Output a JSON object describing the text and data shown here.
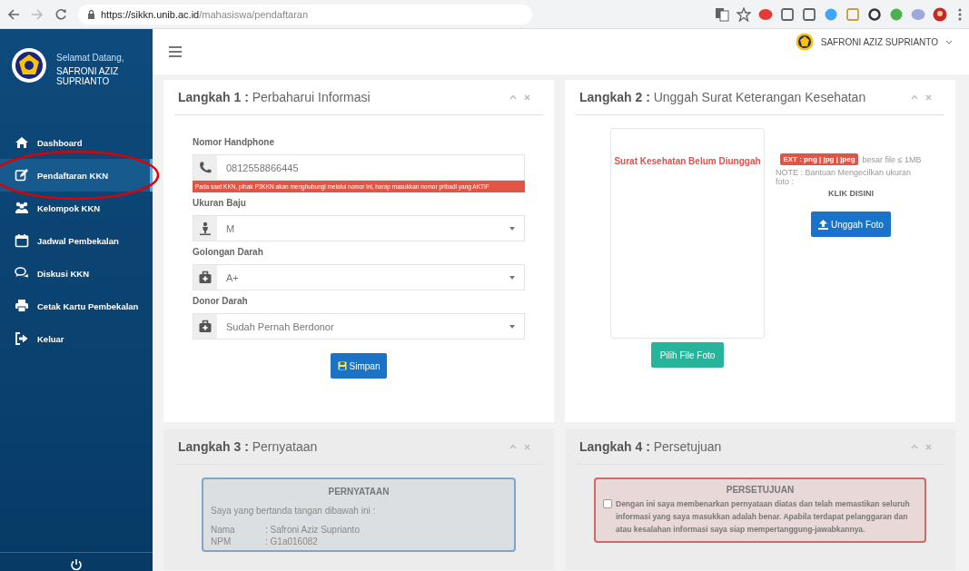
{
  "browser": {
    "url_host": "https://sikkn.unib.ac.id",
    "url_path": "/mahasiswa/pendaftaran"
  },
  "sidebar": {
    "greeting": "Selamat Datang,",
    "user_name": "SAFRONI AZIZ SUPRIANTO",
    "items": [
      {
        "label": "Dashboard",
        "selected": false,
        "circled": false
      },
      {
        "label": "Pendaftaran KKN",
        "selected": true,
        "circled": true
      },
      {
        "label": "Kelompok KKN",
        "selected": false,
        "circled": false
      },
      {
        "label": "Jadwal Pembekalan",
        "selected": false,
        "circled": false
      },
      {
        "label": "Diskusi KKN",
        "selected": false,
        "circled": false
      },
      {
        "label": "Cetak Kartu Pembekalan",
        "selected": false,
        "circled": false
      },
      {
        "label": "Keluar",
        "selected": false,
        "circled": false
      }
    ]
  },
  "topbar": {
    "user_name": "SAFRONI AZIZ SUPRIANTO"
  },
  "cards": [
    {
      "kind": "form",
      "title": "**Langkah 1 :** Perbaharui Informasi",
      "fields": [
        {
          "kind": "text",
          "label": "Nomor Handphone",
          "value": "0812558866445",
          "help": "Pada saat KKN, pihak P3KKN akan menghubungi melalui nomor ini, harap masukkan nomor pribadi yang AKTIF"
        },
        {
          "kind": "select",
          "label": "Ukuran Baju",
          "value": "M"
        },
        {
          "kind": "select",
          "label": "Golongan Darah",
          "value": "A+"
        },
        {
          "kind": "select",
          "label": "Donor Darah",
          "value": "Sudah Pernah Berdonor"
        }
      ],
      "button": "Simpan"
    },
    {
      "kind": "upload",
      "title": "**Langkah 2 :** Unggah Surat Keterangan Kesehatan",
      "status": "Surat Kesehatan Belum Diunggah",
      "choose_button": "Pilih File Foto",
      "ext_badge": "EXT : png | jpg | jpeg",
      "size_note": "besar file ≤ 1MB",
      "note": "NOTE : Bantuan Mengecilkan ukuran foto :",
      "link": "KLIK DISINI",
      "upload_button": "Unggah Foto"
    },
    {
      "kind": "statement",
      "title": "**Langkah 3 :** Pernyataan",
      "heading": "PERNYATAAN",
      "intro": "Saya yang bertanda tangan dibawah ini :",
      "rows": [
        {
          "key": "Nama",
          "value": ": Safroni Aziz Suprianto"
        },
        {
          "key": "NPM",
          "value": ": G1a016082"
        }
      ]
    },
    {
      "kind": "agreement",
      "title": "**Langkah 4 :** Persetujuan",
      "heading": "PERSETUJUAN",
      "checked": false,
      "text": "Dengan ini saya membenarkan pernyataan diatas dan telah memastikan seluruh informasi yang saya masukkan adalah benar. Apabila terdapat pelanggaran dan atau kesalahan informasi saya siap mempertanggung-jawabkannya."
    }
  ]
}
